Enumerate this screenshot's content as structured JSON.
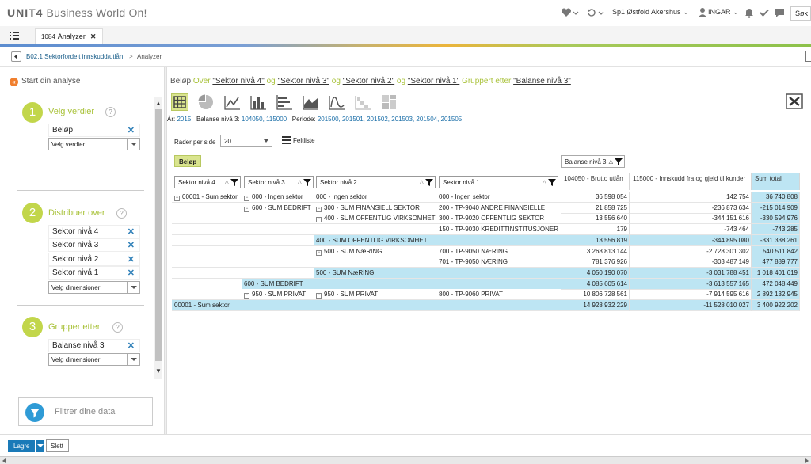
{
  "app": {
    "logo_brand": "UNIT4",
    "logo_product": "Business World On!"
  },
  "topbar": {
    "company": "Sp1 Østfold Akershus",
    "user": "INGAR",
    "search_label": "Søk"
  },
  "tabs": [
    {
      "number": "1084",
      "label": "Analyzer"
    }
  ],
  "breadcrumb": {
    "item1": "B02.1 Sektorfordelt innskudd/utlån",
    "separator": ">",
    "item2": "Analyzer"
  },
  "left": {
    "start_label": "Start din analyse",
    "step1": {
      "number": "1",
      "label": "Velg verdier",
      "chips": [
        "Beløp"
      ],
      "select": "Velg verdier"
    },
    "step2": {
      "number": "2",
      "label": "Distribuer over",
      "chips": [
        "Sektor nivå 4",
        "Sektor nivå 3",
        "Sektor nivå 2",
        "Sektor nivå 1"
      ],
      "select": "Velg dimensioner"
    },
    "step3": {
      "number": "3",
      "label": "Grupper etter",
      "chips": [
        "Balanse nivå 3"
      ],
      "select": "Velg dimensioner"
    },
    "help": "?",
    "filter_label": "Filtrer dine data"
  },
  "query": {
    "measure": "Beløp",
    "over": "Over",
    "dim1": "\"Sektor nivå 4\"",
    "og": "og",
    "dim2": "\"Sektor nivå 3\"",
    "dim3": "\"Sektor nivå 2\"",
    "dim4": "\"Sektor nivå 1\"",
    "gruppert": "Gruppert etter",
    "group": "\"Balanse nivå 3\""
  },
  "filters": {
    "year_label": "År:",
    "year": "2015",
    "bal_label": "Balanse nivå 3:",
    "bal": "104050, 115000",
    "period_label": "Periode:",
    "period": "201500, 201501, 201502, 201503, 201504, 201505"
  },
  "toolbar": {
    "rows_label": "Rader per side",
    "rows_value": "20",
    "feltliste": "Feltliste"
  },
  "pivot": {
    "measure_chip": "Beløp",
    "column_dim": "Balanse nivå 3",
    "row_dims": [
      "Sektor nivå 4",
      "Sektor nivå 3",
      "Sektor nivå 2",
      "Sektor nivå 1"
    ],
    "value_columns": [
      "104050 - Brutto utlån",
      "115000 - Innskudd fra og gjeld til kunder",
      "Sum total"
    ],
    "rows": [
      {
        "c4": "00001 - Sum sektor",
        "c3": "000 - Ingen sektor",
        "c2": "000 - Ingen sektor",
        "c1": "000 - Ingen sektor",
        "v": [
          "36 598 054",
          "142 754",
          "36 740 808"
        ]
      },
      {
        "c4": "",
        "c3": "600 - SUM BEDRIFT",
        "c2": "300 - SUM FINANSIELL SEKTOR",
        "c1": "200 - TP-9040 ANDRE FINANSIELLE",
        "v": [
          "21 858 725",
          "-236 873 634",
          "-215 014 909"
        ]
      },
      {
        "c4": "",
        "c3": "",
        "c2": "400 - SUM OFFENTLIG VIRKSOMHET",
        "c1": "300 - TP-9020 OFFENTLIG SEKTOR",
        "v": [
          "13 556 640",
          "-344 151 616",
          "-330 594 976"
        ]
      },
      {
        "c4": "",
        "c3": "",
        "c2": "",
        "c1": "150 - TP-9030 KREDITTINSTITUSJONER",
        "v": [
          "179",
          "-743 464",
          "-743 285"
        ]
      },
      {
        "c4": "",
        "c3": "",
        "c2": "400 - SUM OFFENTLIG VIRKSOMHET",
        "c1": "",
        "v": [
          "13 556 819",
          "-344 895 080",
          "-331 338 261"
        ]
      },
      {
        "c4": "",
        "c3": "",
        "c2": "500 - SUM NæRING",
        "c1": "700 - TP-9050 NÆRING",
        "v": [
          "3 268 813 144",
          "-2 728 301 302",
          "540 511 842"
        ]
      },
      {
        "c4": "",
        "c3": "",
        "c2": "",
        "c1": "701 - TP-9050 NÆRING",
        "v": [
          "781 376 926",
          "-303 487 149",
          "477 889 777"
        ]
      },
      {
        "c4": "",
        "c3": "",
        "c2": "500 - SUM NæRING",
        "c1": "",
        "v": [
          "4 050 190 070",
          "-3 031 788 451",
          "1 018 401 619"
        ]
      },
      {
        "c4": "",
        "c3": "600 - SUM BEDRIFT",
        "c2": "",
        "c1": "",
        "v": [
          "4 085 605 614",
          "-3 613 557 165",
          "472 048 449"
        ]
      },
      {
        "c4": "",
        "c3": "950 - SUM PRIVAT",
        "c2": "950 - SUM PRIVAT",
        "c1": "800 - TP-9060 PRIVAT",
        "v": [
          "10 806 728 561",
          "-7 914 595 616",
          "2 892 132 945"
        ]
      },
      {
        "c4": "00001 - Sum sektor",
        "c3": "",
        "c2": "",
        "c1": "",
        "v": [
          "14 928 932 229",
          "-11 528 010 027",
          "3 400 922 202"
        ]
      }
    ]
  },
  "footer": {
    "save": "Lagre",
    "delete": "Slett"
  },
  "colors": {
    "accent_green": "#a9c23a",
    "step_circle": "#c2d64b",
    "total_blue": "#bde5f3",
    "primary_blue": "#1a7ab8",
    "link_blue": "#1a6ea8"
  }
}
